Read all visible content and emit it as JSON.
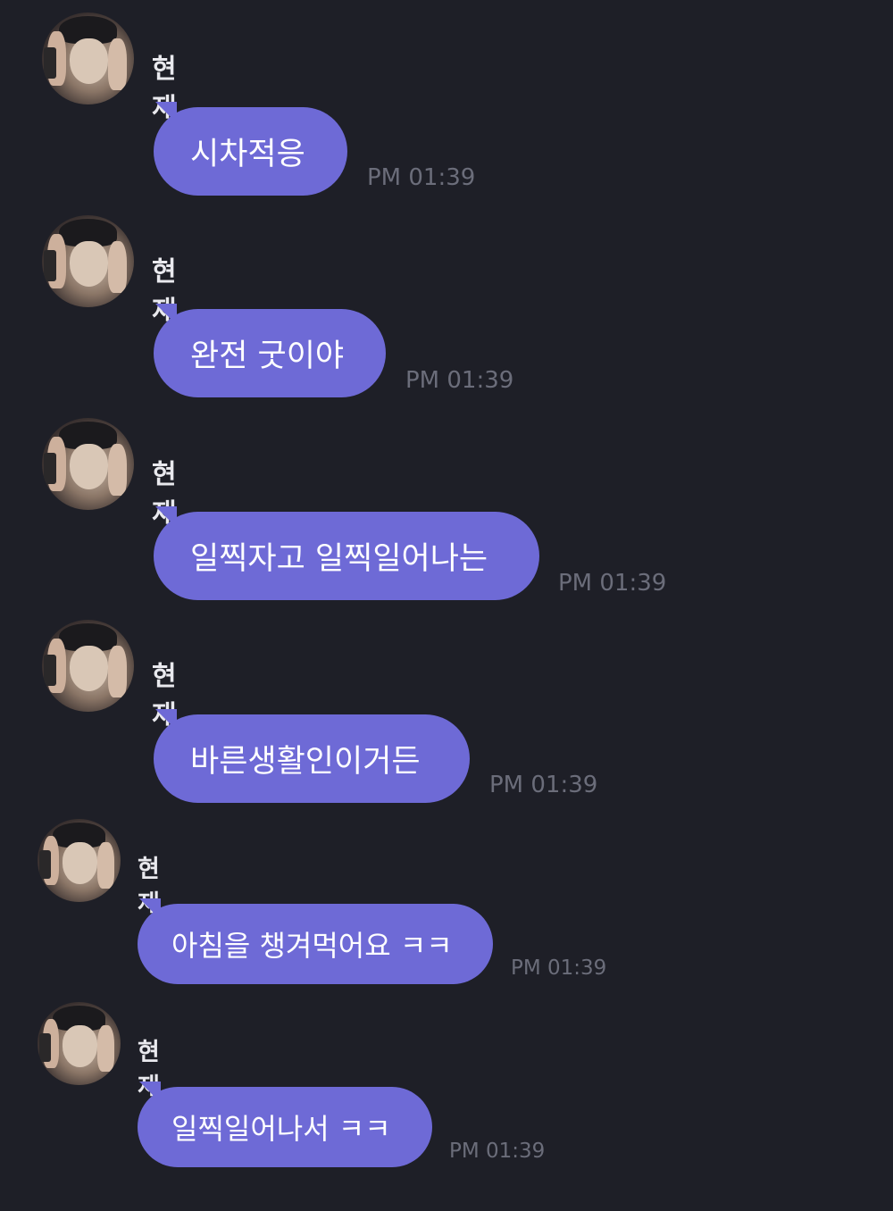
{
  "sender": {
    "name": "현재"
  },
  "messages": [
    {
      "text": "시차적응",
      "time": "PM 01:39"
    },
    {
      "text": "완전 굿이야",
      "time": "PM 01:39"
    },
    {
      "text": "일찍자고 일찍일어나는",
      "time": "PM 01:39"
    },
    {
      "text": "바른생활인이거든",
      "time": "PM 01:39"
    },
    {
      "text": "아침을 챙겨먹어요 ㅋㅋ",
      "time": "PM 01:39"
    },
    {
      "text": "일찍일어나서 ㅋㅋ",
      "time": "PM 01:39"
    }
  ],
  "colors": {
    "background": "#1e1f27",
    "bubble": "#6e6ad6",
    "bubble_text": "#ffffff",
    "name_text": "#e9e9ee",
    "time_text": "#6b6d7a"
  }
}
